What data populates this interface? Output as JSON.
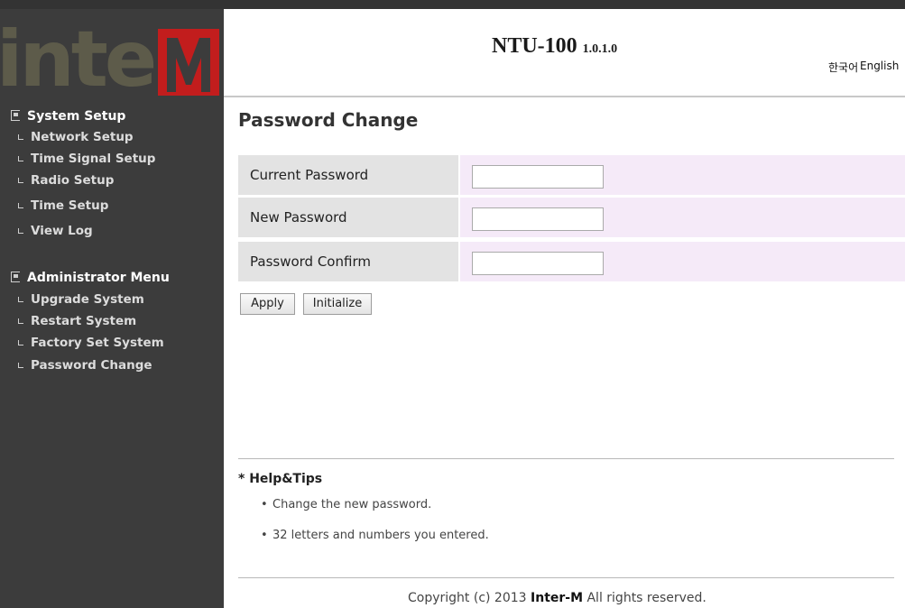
{
  "logo": {
    "text": "inter",
    "icon": "inter-m-logo"
  },
  "header": {
    "product": "NTU-100",
    "version": "1.0.1.0",
    "lang_ko": "한국어",
    "lang_en": "English"
  },
  "sidebar": {
    "system_setup": "System Setup",
    "system_items": [
      "Network Setup",
      "Time Signal Setup",
      "Radio Setup",
      "Time Setup",
      "View Log"
    ],
    "admin_menu": "Administrator Menu",
    "admin_items": [
      "Upgrade System",
      "Restart System",
      "Factory Set System",
      "Password Change"
    ]
  },
  "main": {
    "title": "Password Change",
    "fields": [
      {
        "label": "Current Password",
        "value": ""
      },
      {
        "label": "New Password",
        "value": ""
      },
      {
        "label": "Password Confirm",
        "value": ""
      }
    ],
    "apply_label": "Apply",
    "initialize_label": "Initialize"
  },
  "help": {
    "title": "* Help&Tips",
    "tips": [
      "Change the new password.",
      "32 letters and numbers you entered."
    ]
  },
  "footer": {
    "prefix": "Copyright (c) 2013 ",
    "brand": "Inter-M",
    "suffix": " All rights reserved."
  },
  "colors": {
    "sidebar": "#3c3c3c",
    "logo_red": "#c21d1d",
    "field_value_bg": "#f5eaf8",
    "field_label_bg": "#e3e3e3"
  }
}
